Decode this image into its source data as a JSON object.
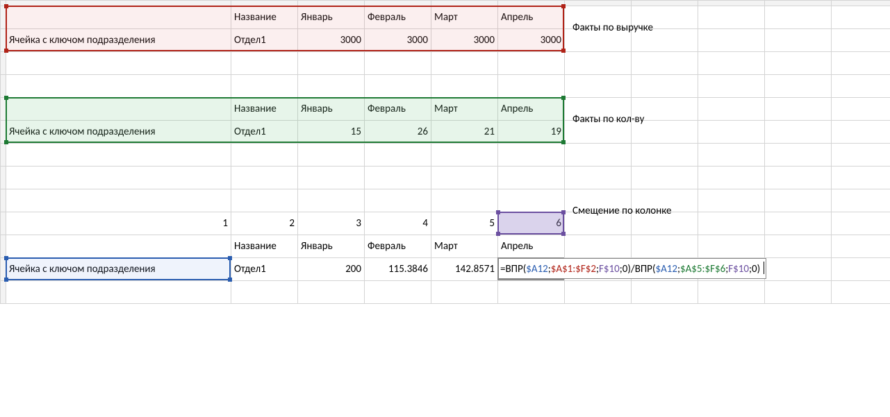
{
  "labels": {
    "key_cell": "Ячейка с ключом подразделения",
    "name_hdr": "Название",
    "months": {
      "jan": "Январь",
      "feb": "Февраль",
      "mar": "Март",
      "apr": "Апрель"
    },
    "revenue_facts": "Факты по выручке",
    "qty_facts": "Факты по кол-ву",
    "col_offset": "Смещение по колонке",
    "dept": "Отдел1"
  },
  "revenue": {
    "jan": "3000",
    "feb": "3000",
    "mar": "3000",
    "apr": "3000"
  },
  "qty": {
    "jan": "15",
    "feb": "26",
    "mar": "21",
    "apr": "19"
  },
  "offsets": {
    "a": "1",
    "b": "2",
    "c": "3",
    "d": "4",
    "e": "5",
    "f": "6"
  },
  "result": {
    "jan": "200",
    "feb": "115.3846",
    "mar": "142.8571"
  },
  "formula": {
    "eq": "=",
    "fn": "ВПР",
    "lp": "(",
    "rp": ")",
    "sc": ";",
    "sl": "/",
    "zero": "0",
    "ref_a12": "$A12",
    "ref_rng1": "$A$1:$F$2",
    "ref_rng2": "$A$5:$F$6",
    "ref_f10": "F$10"
  }
}
